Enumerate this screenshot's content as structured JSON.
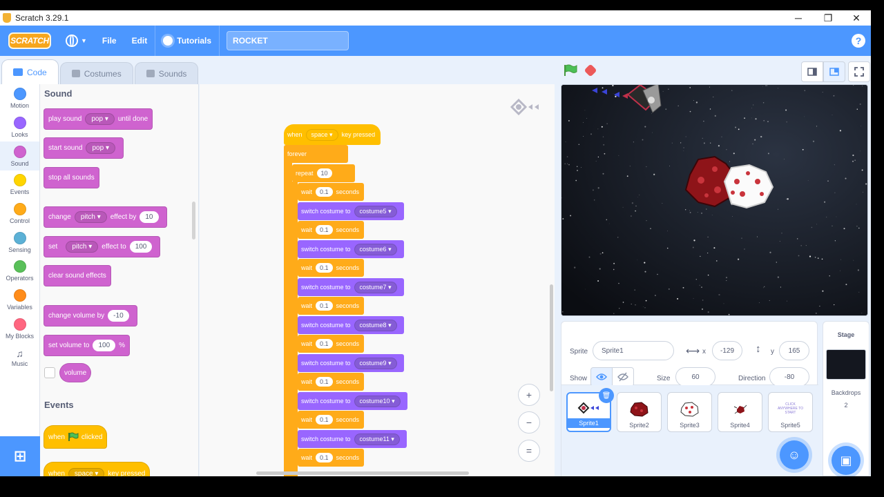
{
  "window": {
    "title": "Scratch 3.29.1",
    "minimize": "─",
    "restore": "❐",
    "close": "✕"
  },
  "menu": {
    "logo": "SCRATCH",
    "file": "File",
    "edit": "Edit",
    "tutorials": "Tutorials",
    "project_title": "ROCKET",
    "help": "?"
  },
  "tabs": [
    {
      "label": "Code"
    },
    {
      "label": "Costumes"
    },
    {
      "label": "Sounds"
    }
  ],
  "categories": [
    {
      "label": "Motion",
      "color": "#4c97ff"
    },
    {
      "label": "Looks",
      "color": "#9966ff"
    },
    {
      "label": "Sound",
      "color": "#cf63cf"
    },
    {
      "label": "Events",
      "color": "#ffd500"
    },
    {
      "label": "Control",
      "color": "#ffab19"
    },
    {
      "label": "Sensing",
      "color": "#5cb1d6"
    },
    {
      "label": "Operators",
      "color": "#59c059"
    },
    {
      "label": "Variables",
      "color": "#ff8c1a"
    },
    {
      "label": "My Blocks",
      "color": "#ff6680"
    },
    {
      "label": "Music",
      "color": "#0fbd8c"
    }
  ],
  "palette": {
    "sound_heading": "Sound",
    "play_sound": {
      "text": "play sound",
      "menu": "pop",
      "suffix": "until done"
    },
    "start_sound": {
      "text": "start sound",
      "menu": "pop"
    },
    "stop_all": "stop all sounds",
    "change_effect": {
      "text": "change",
      "menu": "pitch",
      "mid": "effect by",
      "value": "10"
    },
    "set_effect": {
      "text": "set",
      "menu": "pitch",
      "mid": "effect to",
      "value": "100"
    },
    "clear_effects": "clear sound effects",
    "change_volume": {
      "text": "change volume by",
      "value": "-10"
    },
    "set_volume": {
      "text": "set volume to",
      "value": "100",
      "suffix": "%"
    },
    "volume_reporter": "volume",
    "events_heading": "Events",
    "when_flag": {
      "text": "when",
      "suffix": "clicked"
    },
    "when_key": {
      "text": "when",
      "menu": "space",
      "suffix": "key pressed"
    }
  },
  "script": {
    "hat": {
      "text": "when",
      "menu": "space",
      "suffix": "key pressed"
    },
    "forever": "forever",
    "repeat": {
      "text": "repeat",
      "value": "10"
    },
    "wait": {
      "text": "wait",
      "value": "0.1",
      "suffix": "seconds"
    },
    "switch_label": "switch costume to",
    "costumes": [
      "costume5",
      "costume6",
      "costume7",
      "costume8",
      "costume9",
      "costume10",
      "costume11"
    ]
  },
  "zoom": {
    "in": "+",
    "out": "−",
    "reset": "="
  },
  "sprite_info": {
    "sprite_label": "Sprite",
    "sprite_name": "Sprite1",
    "x_label": "x",
    "x_value": "-129",
    "y_label": "y",
    "y_value": "165",
    "show_label": "Show",
    "size_label": "Size",
    "size_value": "60",
    "direction_label": "Direction",
    "direction_value": "-80"
  },
  "sprites": [
    {
      "name": "Sprite1",
      "selected": true
    },
    {
      "name": "Sprite2"
    },
    {
      "name": "Sprite3"
    },
    {
      "name": "Sprite4"
    },
    {
      "name": "Sprite5"
    }
  ],
  "sprite5_thumb_text": "CLICK ANYWHERE TO START",
  "stage_panel": {
    "title": "Stage",
    "backdrops_label": "Backdrops",
    "backdrops_count": "2"
  },
  "colors": {
    "accent": "#4c97ff",
    "sound": "#cf63cf",
    "events": "#ffbf00",
    "control": "#ffab19",
    "looks": "#9966ff"
  }
}
